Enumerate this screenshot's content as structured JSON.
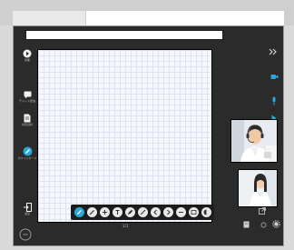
{
  "window": {
    "address_value": ""
  },
  "sidebar": {
    "items": [
      {
        "id": "play",
        "label": "授業",
        "icon": "play-icon"
      },
      {
        "id": "chat",
        "label": "チャット配信",
        "icon": "chat-icon"
      },
      {
        "id": "material",
        "label": "共有資料",
        "icon": "document-icon"
      },
      {
        "id": "whiteboard",
        "label": "ホワイトボード",
        "icon": "pen-icon",
        "active": true
      },
      {
        "id": "exit",
        "label": "退室",
        "icon": "exit-icon"
      }
    ]
  },
  "canvas": {
    "page_indicator": "1/1"
  },
  "colors": {
    "accent": "#2aa7d8",
    "dark_panel": "#2b2b2b",
    "canvas_bg": "#f6f8fd"
  },
  "toolbar": {
    "tools": [
      {
        "name": "pen-tool",
        "icon": "pen-icon",
        "active": true
      },
      {
        "name": "pencil-tool",
        "icon": "pencil-icon"
      },
      {
        "name": "add-tool",
        "icon": "plus-icon"
      },
      {
        "name": "text-tool",
        "icon": "text-icon"
      },
      {
        "name": "marker-tool",
        "icon": "marker-icon"
      },
      {
        "name": "line-tool",
        "icon": "line-icon"
      },
      {
        "name": "undo-tool",
        "icon": "undo-icon"
      },
      {
        "name": "redo-tool",
        "icon": "redo-icon"
      },
      {
        "name": "move-tool",
        "icon": "move-icon"
      },
      {
        "name": "image-tool",
        "icon": "image-icon"
      },
      {
        "name": "clear-tool",
        "icon": "eraser-icon"
      }
    ]
  },
  "rightpanel": {
    "icons": [
      "double-chevron-right-icon",
      "camera-icon",
      "microphone-icon",
      "cursor-icon",
      "whiteboard-small-icon",
      "settings-icon",
      "gear-icon"
    ]
  }
}
